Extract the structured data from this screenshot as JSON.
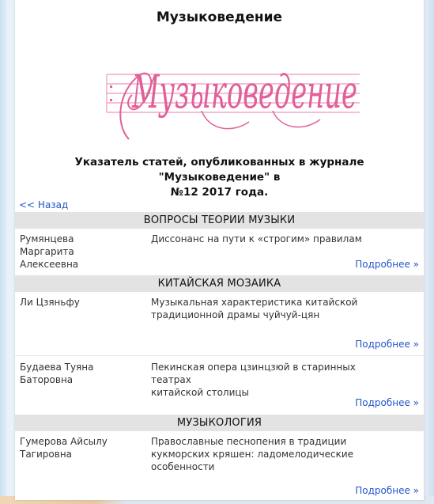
{
  "page": {
    "title": "Музыковедение",
    "logo_text": "Музыковедение",
    "intro_line1": "Указатель статей, опубликованных в журнале \"Музыковедение\" в",
    "intro_line2": "№12 2017 года.",
    "back_label": "<< Назад"
  },
  "sections": [
    {
      "heading": "ВОПРОСЫ ТЕОРИИ МУЗЫКИ",
      "articles": [
        {
          "author_lines": [
            "Румянцева",
            "Маргарита",
            "Алексеевна"
          ],
          "title_lines": [
            "Диссонанс на пути к «строгим» правилам"
          ],
          "more": "Подробнее »"
        }
      ]
    },
    {
      "heading": "КИТАЙСКАЯ МОЗАИКА",
      "articles": [
        {
          "author_lines": [
            "Ли Цзяньфу"
          ],
          "title_lines": [
            "Музыкальная характеристика китайской",
            "традиционной драмы чуйчуй-цян"
          ],
          "more": "Подробнее »"
        },
        {
          "author_lines": [
            "Будаева Туяна",
            "Баторовна"
          ],
          "title_lines": [
            "Пекинская опера цзинцзюй в старинных театрах",
            "китайской столицы"
          ],
          "more": "Подробнее »"
        }
      ]
    },
    {
      "heading": "МУЗЫКОЛОГИЯ",
      "articles": [
        {
          "author_lines": [
            "Гумерова Айсылу",
            "Тагировна"
          ],
          "title_lines": [
            "Православные песнопения в традиции",
            "кукморских кряшен: ладомелодические",
            "особенности"
          ],
          "more": "Подробнее »"
        }
      ]
    }
  ],
  "colors": {
    "link": "#2255cc",
    "section_bg": "#e3e3e3",
    "logo_pink": "#e0609a",
    "staff_pink": "#f2a9c8"
  }
}
